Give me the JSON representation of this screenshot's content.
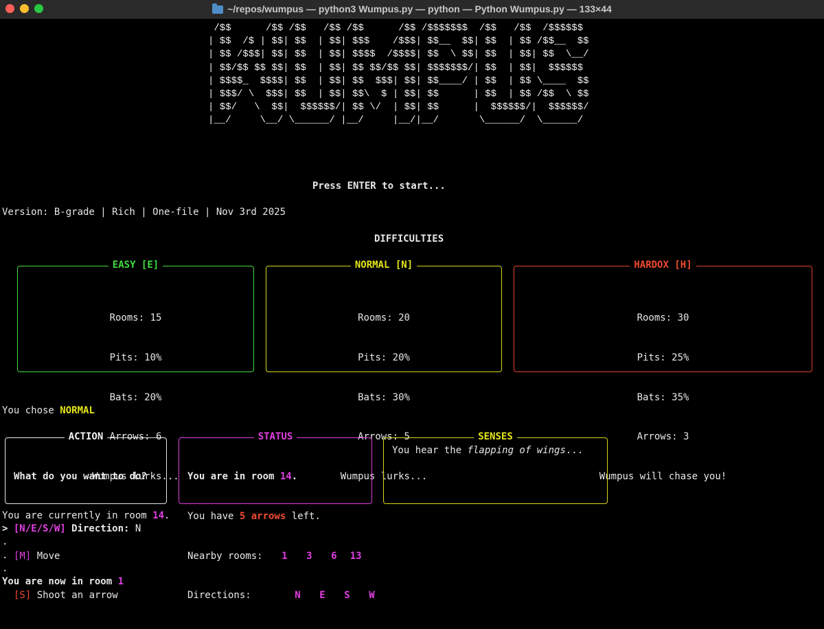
{
  "window": {
    "title": "~/repos/wumpus — python3 Wumpus.py — python — Python Wumpus.py — 133×44"
  },
  "banner": {
    "lines": [
      " /$$      /$$ /$$   /$$ /$$      /$$ /$$$$$$$  /$$   /$$  /$$$$$$ ",
      "| $$  /$ | $$| $$  | $$| $$$    /$$$| $$__  $$| $$  | $$ /$$__  $$",
      "| $$ /$$$| $$| $$  | $$| $$$$  /$$$$| $$  \\ $$| $$  | $$| $$  \\__/",
      "| $$/$$ $$ $$| $$  | $$| $$ $$/$$ $$| $$$$$$$/| $$  | $$|  $$$$$$ ",
      "| $$$$_  $$$$| $$  | $$| $$  $$$| $$| $$____/ | $$  | $$ \\____  $$",
      "| $$$/ \\  $$$| $$  | $$| $$\\  $ | $$| $$      | $$  | $$ /$$  \\ $$",
      "| $$/   \\  $$|  $$$$$$/| $$ \\/  | $$| $$      |  $$$$$$/|  $$$$$$/",
      "|__/     \\__/ \\______/ |__/     |__/|__/       \\______/  \\______/ "
    ]
  },
  "prompt_start": "Press ENTER to start...",
  "version": "Version: B-grade | Rich | One-file | Nov 3rd 2025",
  "difficulties": {
    "heading": "DIFFICULTIES",
    "easy": {
      "title": "EASY [E]",
      "rooms": "Rooms: 15",
      "pits": "Pits: 10%",
      "bats": "Bats: 20%",
      "arrows": "Arrows: 6",
      "wumpus": "Wumpus lurks...",
      "color": "#3fdc3f"
    },
    "normal": {
      "title": "NORMAL [N]",
      "rooms": "Rooms: 20",
      "pits": "Pits: 20%",
      "bats": "Bats: 30%",
      "arrows": "Arrows: 5",
      "wumpus": "Wumpus lurks...",
      "color": "#e5e51a"
    },
    "hard": {
      "title": "HARDOX [H]",
      "rooms": "Rooms: 30",
      "pits": "Pits: 25%",
      "bats": "Bats: 35%",
      "arrows": "Arrows: 3",
      "wumpus": "Wumpus will chase you!",
      "color": "#ef4a30"
    }
  },
  "chose": {
    "prefix": "You chose ",
    "value": "NORMAL"
  },
  "action": {
    "title": "ACTION",
    "question": "What do you want to do?",
    "move_key": "[M]",
    "move_label": " Move",
    "shoot_key": "[S]",
    "shoot_label": " Shoot an arrow"
  },
  "status": {
    "title": "STATUS",
    "room_prefix": "You are in room ",
    "room": "14",
    "room_suffix": ".",
    "arrows_prefix": "You have ",
    "arrows": "5 arrows",
    "arrows_suffix": " left.",
    "nearby_label": "Nearby rooms:",
    "nearby": [
      "1",
      "3",
      "6",
      "13"
    ],
    "directions_label": "Directions:",
    "directions": [
      "N",
      "E",
      "S",
      "W"
    ]
  },
  "senses": {
    "title": "SENSES",
    "prefix": "You hear the ",
    "italic": "flapping of wings",
    "suffix": "..."
  },
  "log": {
    "current_prefix": "You are currently in room ",
    "current_room": "14",
    "current_suffix": ".",
    "prompt_caret": "> ",
    "prompt_keys": "[N/E/S/W]",
    "prompt_label": " Direction: ",
    "prompt_input": "N",
    "dots": [
      ".",
      ".",
      "."
    ],
    "now_prefix": "You are now in room ",
    "now_room": "1"
  }
}
